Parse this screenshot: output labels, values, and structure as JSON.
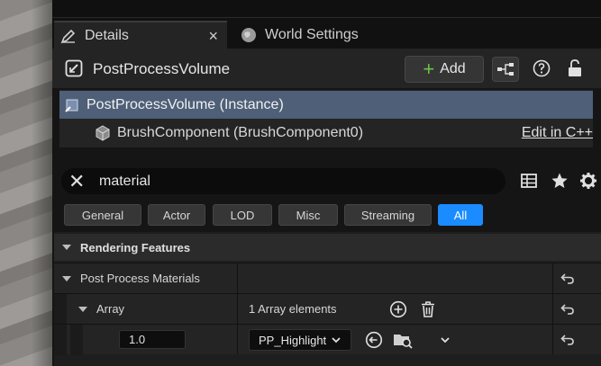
{
  "tabs": [
    {
      "label": "Details",
      "icon": "pencil-icon",
      "close": "×"
    },
    {
      "label": "World Settings",
      "icon": "globe-icon"
    }
  ],
  "header": {
    "title": "PostProcessVolume",
    "add_label": "Add",
    "icons": [
      "hierarchy-icon",
      "help-icon",
      "lock-icon"
    ]
  },
  "tree": {
    "selected": "PostProcessVolume (Instance)",
    "child": "BrushComponent (BrushComponent0)",
    "edit_link": "Edit in C++"
  },
  "search": {
    "value": "material",
    "clear_glyph": "✕",
    "tools": [
      "table-icon",
      "star-icon",
      "gear-icon"
    ]
  },
  "filters": [
    {
      "label": "General",
      "active": false
    },
    {
      "label": "Actor",
      "active": false
    },
    {
      "label": "LOD",
      "active": false
    },
    {
      "label": "Misc",
      "active": false
    },
    {
      "label": "Streaming",
      "active": false
    },
    {
      "label": "All",
      "active": true
    }
  ],
  "grid": {
    "section": "Rendering Features",
    "post_process_label": "Post Process Materials",
    "array_label": "Array",
    "array_count": "1 Array elements",
    "element_value": "1.0",
    "element_asset": "PP_Highlight"
  },
  "colors": {
    "accent": "#1a8cff",
    "selection": "#4e5f77",
    "add_plus": "#6cc24a"
  }
}
